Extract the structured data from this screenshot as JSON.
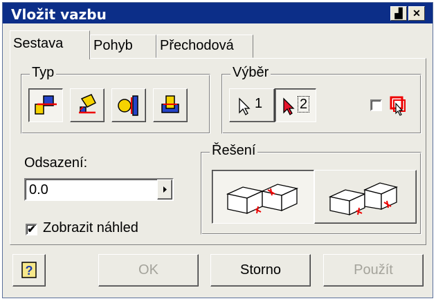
{
  "window": {
    "title": "Vložit vazbu",
    "pin_label": "▟",
    "close_label": "✕"
  },
  "tabs": [
    "Sestava",
    "Pohyb",
    "Přechodová"
  ],
  "typ": {
    "label": "Typ",
    "buttons": [
      "mate-icon",
      "angle-icon",
      "tangent-icon",
      "insert-icon"
    ]
  },
  "vyber": {
    "label": "Výběr",
    "select1": "1",
    "select2": "2"
  },
  "odsazeni": {
    "label": "Odsazení:",
    "value": "0.0"
  },
  "reseni": {
    "label": "Řešení"
  },
  "preview": {
    "label": "Zobrazit náhled",
    "checked": true
  },
  "footer": {
    "ok": "OK",
    "cancel": "Storno",
    "apply": "Použít"
  },
  "colors": {
    "title_bg": "#0c2e88",
    "dialog_bg": "#ecebe4"
  }
}
